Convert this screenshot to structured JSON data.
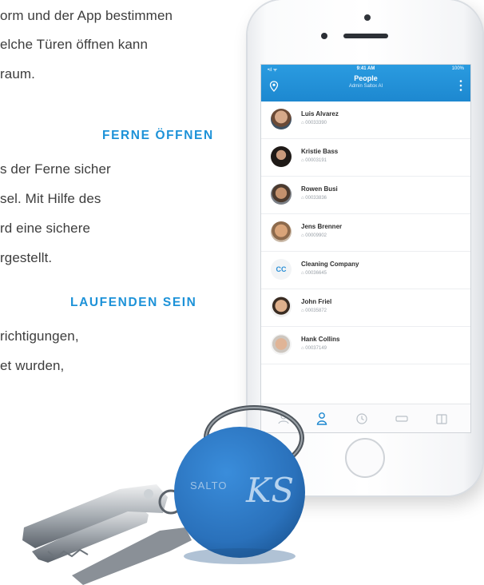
{
  "text": {
    "intro_lines": [
      "orm und der App bestimmen",
      "elche Türen öffnen kann",
      "raum."
    ],
    "heading_1": "FERNE ÖFFNEN",
    "section_1_lines": [
      "s der Ferne sicher",
      "sel. Mit Hilfe des",
      "rd eine sichere",
      "rgestellt."
    ],
    "heading_2": "LAUFENDEN SEIN",
    "section_2_lines": [
      "richtigungen,",
      "et wurden,"
    ]
  },
  "app": {
    "status_time": "9:41 AM",
    "status_battery": "100%",
    "status_signal": "•ıl ᯤ",
    "title": "People",
    "subtitle": "Admin Saltox AI",
    "people": [
      {
        "name": "Luis Alvarez",
        "id": "⌂ 00033390",
        "avatar": "photo"
      },
      {
        "name": "Kristie Bass",
        "id": "⌂ 00003191",
        "avatar": "photo"
      },
      {
        "name": "Rowen Busi",
        "id": "⌂ 00033836",
        "avatar": "photo"
      },
      {
        "name": "Jens Brenner",
        "id": "⌂ 00009902",
        "avatar": "photo"
      },
      {
        "name": "Cleaning Company",
        "id": "⌂ 00036645",
        "avatar": "CC"
      },
      {
        "name": "John Friel",
        "id": "⌂ 00035872",
        "avatar": "photo"
      },
      {
        "name": "Hank Collins",
        "id": "⌂ 00037149",
        "avatar": "photo"
      }
    ],
    "tabs": [
      "people",
      "user",
      "history",
      "card",
      "calendar"
    ]
  },
  "fob": {
    "brand": "SALTO",
    "logo": "KS"
  },
  "colors": {
    "accent": "#1d92d8",
    "header": "#1d88d0",
    "fob": "#2779c4"
  }
}
